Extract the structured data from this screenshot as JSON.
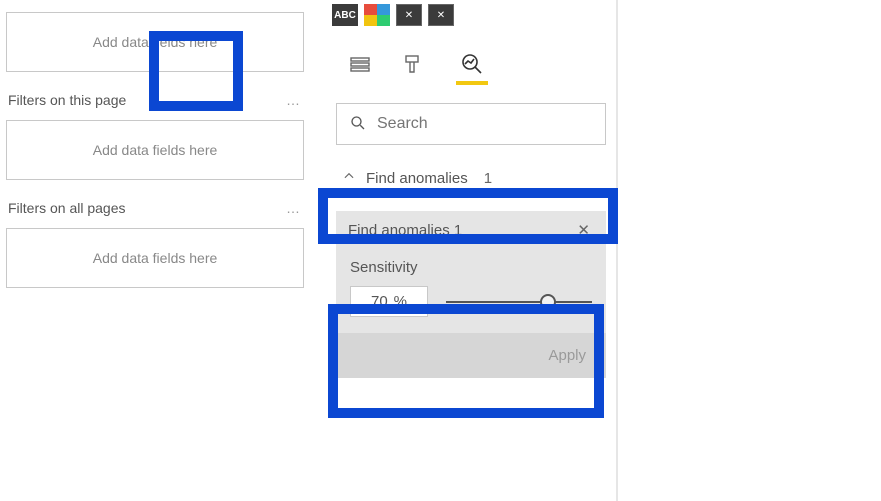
{
  "filters": {
    "visual_drop": "Add data fields here",
    "page_heading": "Filters on this page",
    "page_drop": "Add data fields here",
    "all_heading": "Filters on all pages",
    "all_drop": "Add data fields here",
    "more": "…"
  },
  "viz": {
    "search_placeholder": "Search",
    "find_label": "Find anomalies",
    "find_count": "1",
    "card_title": "Find anomalies 1",
    "sensitivity_label": "Sensitivity",
    "sensitivity_value": "70",
    "sensitivity_unit": "%",
    "apply_label": "Apply"
  },
  "highlight": {
    "color": "#0b47d2",
    "underline": "#f2c811"
  }
}
